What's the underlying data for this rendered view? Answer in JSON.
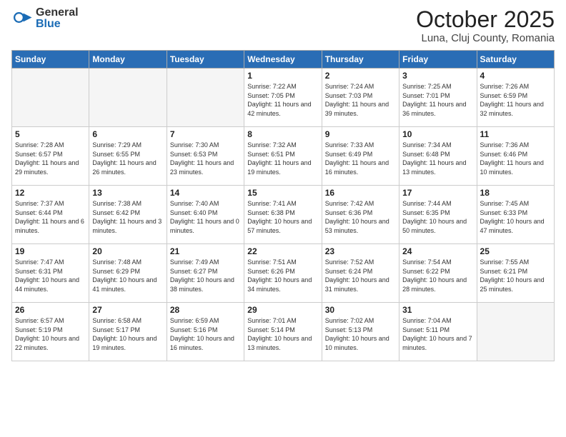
{
  "logo": {
    "general": "General",
    "blue": "Blue"
  },
  "title": "October 2025",
  "subtitle": "Luna, Cluj County, Romania",
  "days_header": [
    "Sunday",
    "Monday",
    "Tuesday",
    "Wednesday",
    "Thursday",
    "Friday",
    "Saturday"
  ],
  "weeks": [
    [
      {
        "day": "",
        "sunrise": "",
        "sunset": "",
        "daylight": ""
      },
      {
        "day": "",
        "sunrise": "",
        "sunset": "",
        "daylight": ""
      },
      {
        "day": "",
        "sunrise": "",
        "sunset": "",
        "daylight": ""
      },
      {
        "day": "1",
        "sunrise": "7:22 AM",
        "sunset": "7:05 PM",
        "daylight": "11 hours and 42 minutes."
      },
      {
        "day": "2",
        "sunrise": "7:24 AM",
        "sunset": "7:03 PM",
        "daylight": "11 hours and 39 minutes."
      },
      {
        "day": "3",
        "sunrise": "7:25 AM",
        "sunset": "7:01 PM",
        "daylight": "11 hours and 36 minutes."
      },
      {
        "day": "4",
        "sunrise": "7:26 AM",
        "sunset": "6:59 PM",
        "daylight": "11 hours and 32 minutes."
      }
    ],
    [
      {
        "day": "5",
        "sunrise": "7:28 AM",
        "sunset": "6:57 PM",
        "daylight": "11 hours and 29 minutes."
      },
      {
        "day": "6",
        "sunrise": "7:29 AM",
        "sunset": "6:55 PM",
        "daylight": "11 hours and 26 minutes."
      },
      {
        "day": "7",
        "sunrise": "7:30 AM",
        "sunset": "6:53 PM",
        "daylight": "11 hours and 23 minutes."
      },
      {
        "day": "8",
        "sunrise": "7:32 AM",
        "sunset": "6:51 PM",
        "daylight": "11 hours and 19 minutes."
      },
      {
        "day": "9",
        "sunrise": "7:33 AM",
        "sunset": "6:49 PM",
        "daylight": "11 hours and 16 minutes."
      },
      {
        "day": "10",
        "sunrise": "7:34 AM",
        "sunset": "6:48 PM",
        "daylight": "11 hours and 13 minutes."
      },
      {
        "day": "11",
        "sunrise": "7:36 AM",
        "sunset": "6:46 PM",
        "daylight": "11 hours and 10 minutes."
      }
    ],
    [
      {
        "day": "12",
        "sunrise": "7:37 AM",
        "sunset": "6:44 PM",
        "daylight": "11 hours and 6 minutes."
      },
      {
        "day": "13",
        "sunrise": "7:38 AM",
        "sunset": "6:42 PM",
        "daylight": "11 hours and 3 minutes."
      },
      {
        "day": "14",
        "sunrise": "7:40 AM",
        "sunset": "6:40 PM",
        "daylight": "11 hours and 0 minutes."
      },
      {
        "day": "15",
        "sunrise": "7:41 AM",
        "sunset": "6:38 PM",
        "daylight": "10 hours and 57 minutes."
      },
      {
        "day": "16",
        "sunrise": "7:42 AM",
        "sunset": "6:36 PM",
        "daylight": "10 hours and 53 minutes."
      },
      {
        "day": "17",
        "sunrise": "7:44 AM",
        "sunset": "6:35 PM",
        "daylight": "10 hours and 50 minutes."
      },
      {
        "day": "18",
        "sunrise": "7:45 AM",
        "sunset": "6:33 PM",
        "daylight": "10 hours and 47 minutes."
      }
    ],
    [
      {
        "day": "19",
        "sunrise": "7:47 AM",
        "sunset": "6:31 PM",
        "daylight": "10 hours and 44 minutes."
      },
      {
        "day": "20",
        "sunrise": "7:48 AM",
        "sunset": "6:29 PM",
        "daylight": "10 hours and 41 minutes."
      },
      {
        "day": "21",
        "sunrise": "7:49 AM",
        "sunset": "6:27 PM",
        "daylight": "10 hours and 38 minutes."
      },
      {
        "day": "22",
        "sunrise": "7:51 AM",
        "sunset": "6:26 PM",
        "daylight": "10 hours and 34 minutes."
      },
      {
        "day": "23",
        "sunrise": "7:52 AM",
        "sunset": "6:24 PM",
        "daylight": "10 hours and 31 minutes."
      },
      {
        "day": "24",
        "sunrise": "7:54 AM",
        "sunset": "6:22 PM",
        "daylight": "10 hours and 28 minutes."
      },
      {
        "day": "25",
        "sunrise": "7:55 AM",
        "sunset": "6:21 PM",
        "daylight": "10 hours and 25 minutes."
      }
    ],
    [
      {
        "day": "26",
        "sunrise": "6:57 AM",
        "sunset": "5:19 PM",
        "daylight": "10 hours and 22 minutes."
      },
      {
        "day": "27",
        "sunrise": "6:58 AM",
        "sunset": "5:17 PM",
        "daylight": "10 hours and 19 minutes."
      },
      {
        "day": "28",
        "sunrise": "6:59 AM",
        "sunset": "5:16 PM",
        "daylight": "10 hours and 16 minutes."
      },
      {
        "day": "29",
        "sunrise": "7:01 AM",
        "sunset": "5:14 PM",
        "daylight": "10 hours and 13 minutes."
      },
      {
        "day": "30",
        "sunrise": "7:02 AM",
        "sunset": "5:13 PM",
        "daylight": "10 hours and 10 minutes."
      },
      {
        "day": "31",
        "sunrise": "7:04 AM",
        "sunset": "5:11 PM",
        "daylight": "10 hours and 7 minutes."
      },
      {
        "day": "",
        "sunrise": "",
        "sunset": "",
        "daylight": ""
      }
    ]
  ],
  "labels": {
    "sunrise": "Sunrise:",
    "sunset": "Sunset:",
    "daylight": "Daylight:"
  }
}
